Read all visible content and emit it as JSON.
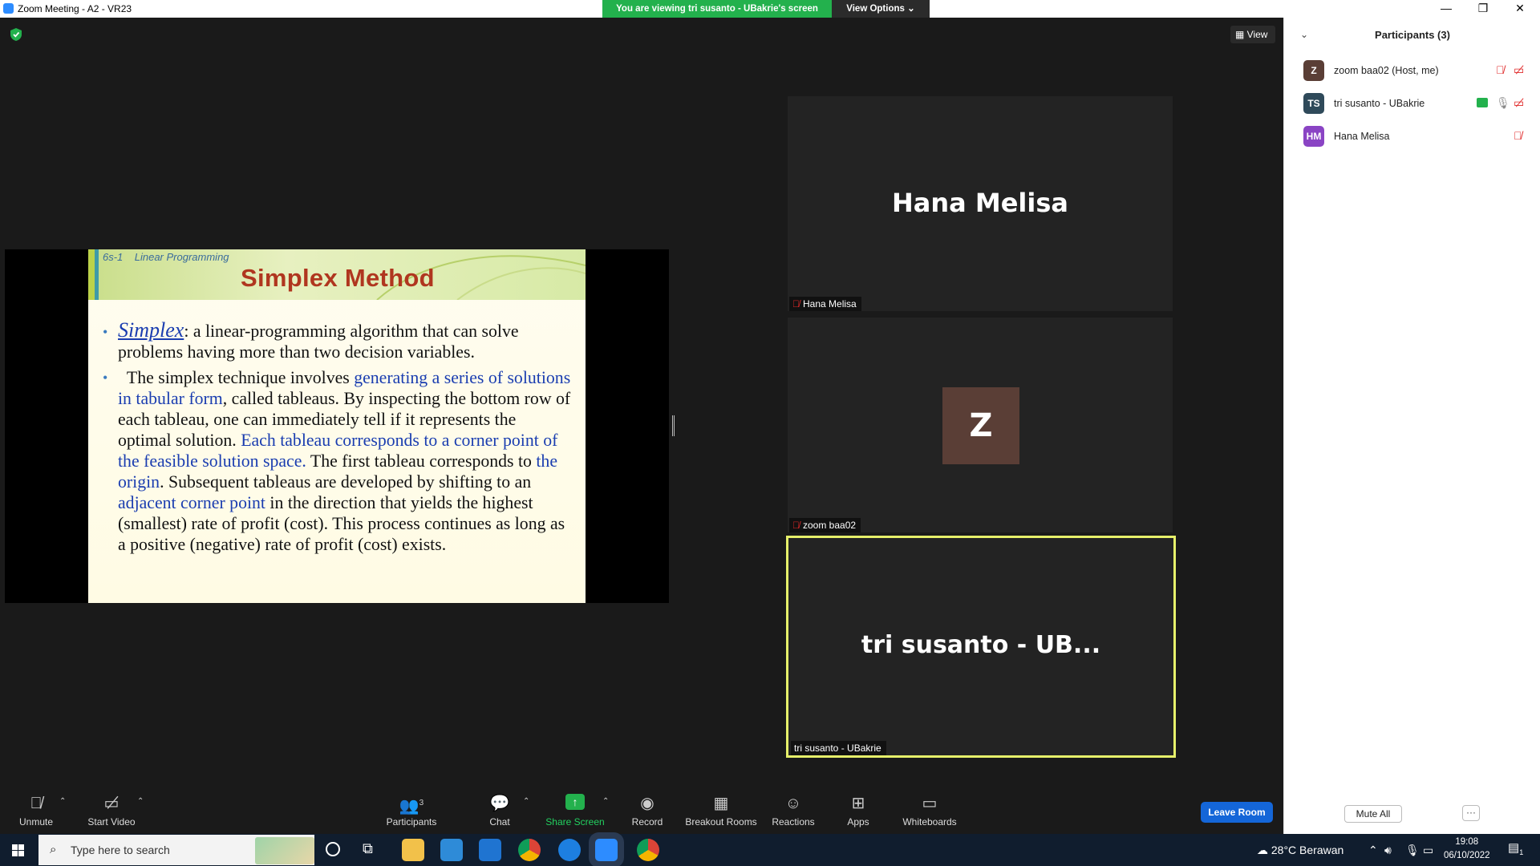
{
  "window": {
    "title": "Zoom Meeting - A2 - VR23",
    "minimize": "—",
    "restore": "❐",
    "close": "✕"
  },
  "banner": {
    "viewing": "You are viewing tri susanto - UBakrie's screen",
    "view_options": "View Options ⌄"
  },
  "stage": {
    "view_label": "View"
  },
  "slide": {
    "code": "6s-1",
    "subject": "Linear Programming",
    "title": "Simplex Method",
    "b1_term": "Simplex",
    "b1_rest": ": a linear-programming algorithm that can solve problems having more than two decision variables.",
    "b2_a": "The simplex technique involves ",
    "b2_b": "generating a series of solutions in tabular form",
    "b2_c": ", called tableaus. By inspecting the bottom row of each tableau, one can immediately tell if it represents the optimal solution. ",
    "b2_d": "Each tableau corresponds to a corner point of the feasible solution space.",
    "b2_e": " The first tableau corresponds to ",
    "b2_f": "the origin",
    "b2_g": ". Subsequent tableaus are developed by shifting to an ",
    "b2_h": "adjacent corner point",
    "b2_i": " in the direction that yields the highest (smallest) rate of profit (cost). This process continues as long as a positive (negative) rate of profit (cost) exists."
  },
  "tiles": {
    "hana_big": "Hana Melisa",
    "hana_label": "Hana Melisa",
    "zoom_avatar": "Z",
    "zoom_label": "zoom baa02",
    "tri_big": "tri susanto - UB...",
    "tri_label": "tri susanto - UBakrie"
  },
  "participants": {
    "header": "Participants (3)",
    "list": [
      {
        "initials": "Z",
        "name": "zoom baa02 (Host, me)",
        "color": "#5a3e36"
      },
      {
        "initials": "TS",
        "name": "tri susanto - UBakrie",
        "color": "#2f4a5a"
      },
      {
        "initials": "HM",
        "name": "Hana Melisa",
        "color": "#8a44c4"
      }
    ],
    "mute_all": "Mute All",
    "more": "···"
  },
  "toolbar": {
    "unmute": "Unmute",
    "start_video": "Start Video",
    "participants": "Participants",
    "participants_count": "3",
    "chat": "Chat",
    "share_screen": "Share Screen",
    "record": "Record",
    "breakout": "Breakout Rooms",
    "reactions": "Reactions",
    "apps": "Apps",
    "whiteboards": "Whiteboards",
    "leave": "Leave Room"
  },
  "taskbar": {
    "search_placeholder": "Type here to search",
    "weather": "28°C  Berawan",
    "time": "19:08",
    "date": "06/10/2022",
    "notif_count": "1"
  },
  "colors": {
    "accent": "#2d8cff",
    "share_green": "#23b14d",
    "active_speaker": "#e6f06a",
    "leave_blue": "#1466d8",
    "mic_off_red": "#e02828"
  }
}
